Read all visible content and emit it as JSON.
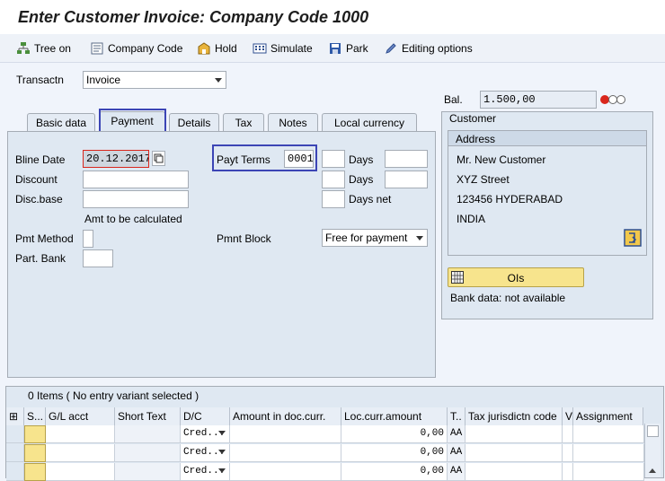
{
  "window": {
    "title": "Enter Customer Invoice: Company Code 1000"
  },
  "toolbar": {
    "items": [
      {
        "label": "Tree on",
        "icon": "tree-icon"
      },
      {
        "label": "Company Code",
        "icon": "company-code-icon"
      },
      {
        "label": "Hold",
        "icon": "hold-icon"
      },
      {
        "label": "Simulate",
        "icon": "simulate-icon"
      },
      {
        "label": "Park",
        "icon": "park-icon"
      },
      {
        "label": "Editing options",
        "icon": "pencil-icon"
      }
    ]
  },
  "header": {
    "transaction_label": "Transactn",
    "transaction_value": "Invoice",
    "balance_label": "Bal.",
    "balance_value": "1.500,00"
  },
  "tabs": [
    "Basic data",
    "Payment",
    "Details",
    "Tax",
    "Notes",
    "Local currency"
  ],
  "active_tab": "Payment",
  "payment": {
    "bline_date_label": "Bline Date",
    "bline_date_value": "20.12.2017",
    "discount_label": "Discount",
    "disc_base_label": "Disc.base",
    "amt_note": "Amt to be calculated",
    "pmt_method_label": "Pmt Method",
    "part_bank_label": "Part. Bank",
    "payt_terms_label": "Payt Terms",
    "payt_terms_value": "0001",
    "days_label": "Days",
    "days_net_label": "Days net",
    "pmnt_block_label": "Pmnt Block",
    "pmnt_block_value": "Free for payment"
  },
  "customer": {
    "title": "Customer",
    "address_title": "Address",
    "lines": [
      "Mr. New Customer",
      "XYZ Street",
      "123456 HYDERABAD",
      "INDIA"
    ],
    "ois_label": "OIs",
    "bank_note": "Bank data: not available"
  },
  "items": {
    "summary": "0 Items ( No entry variant selected )",
    "columns": [
      "S...",
      "G/L acct",
      "Short Text",
      "D/C",
      "Amount in doc.curr.",
      "Loc.curr.amount",
      "T..",
      "Tax jurisdictn code",
      "V",
      "Assignment"
    ],
    "rows": [
      {
        "dc": "Cred...",
        "loc_amount": "0,00",
        "tax": "AA"
      },
      {
        "dc": "Cred...",
        "loc_amount": "0,00",
        "tax": "AA"
      },
      {
        "dc": "Cred...",
        "loc_amount": "0,00",
        "tax": "AA"
      }
    ]
  }
}
